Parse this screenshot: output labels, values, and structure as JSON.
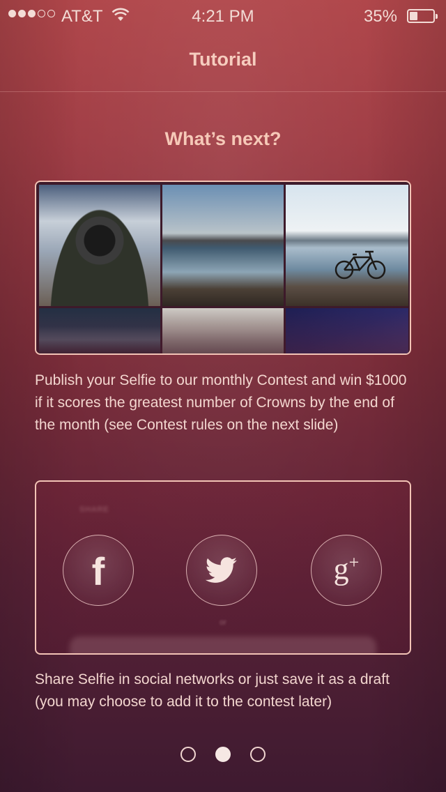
{
  "status_bar": {
    "signal_bars_filled": 3,
    "signal_bars_total": 5,
    "carrier": "AT&T",
    "wifi_icon": "wifi-icon",
    "time": "4:21 PM",
    "battery_percent": "35%",
    "battery_level": 0.35
  },
  "nav": {
    "title": "Tutorial"
  },
  "content": {
    "heading": "What’s next?",
    "paragraph_1": "Publish your Selfie to our monthly Contest and win $1000 if it scores the greatest number of Crowns by the end of the month (see Contest rules on the next slide)",
    "paragraph_2": "Share Selfie in social networks or just save it as a draft (you may choose to add it to the contest later)"
  },
  "share_card": {
    "share_label": "SHARE",
    "or_label": "or",
    "buttons": [
      {
        "name": "facebook",
        "icon": "facebook-icon",
        "glyph": "f"
      },
      {
        "name": "twitter",
        "icon": "twitter-bird-icon"
      },
      {
        "name": "google-plus",
        "icon": "google-plus-icon",
        "glyph": "g+"
      }
    ]
  },
  "pager": {
    "pages": 3,
    "current": 2
  },
  "colors": {
    "background_top": "#b0464a",
    "background_bottom": "#3e1a30",
    "text": "#f3d6cf",
    "border": "#f3c4b6"
  }
}
